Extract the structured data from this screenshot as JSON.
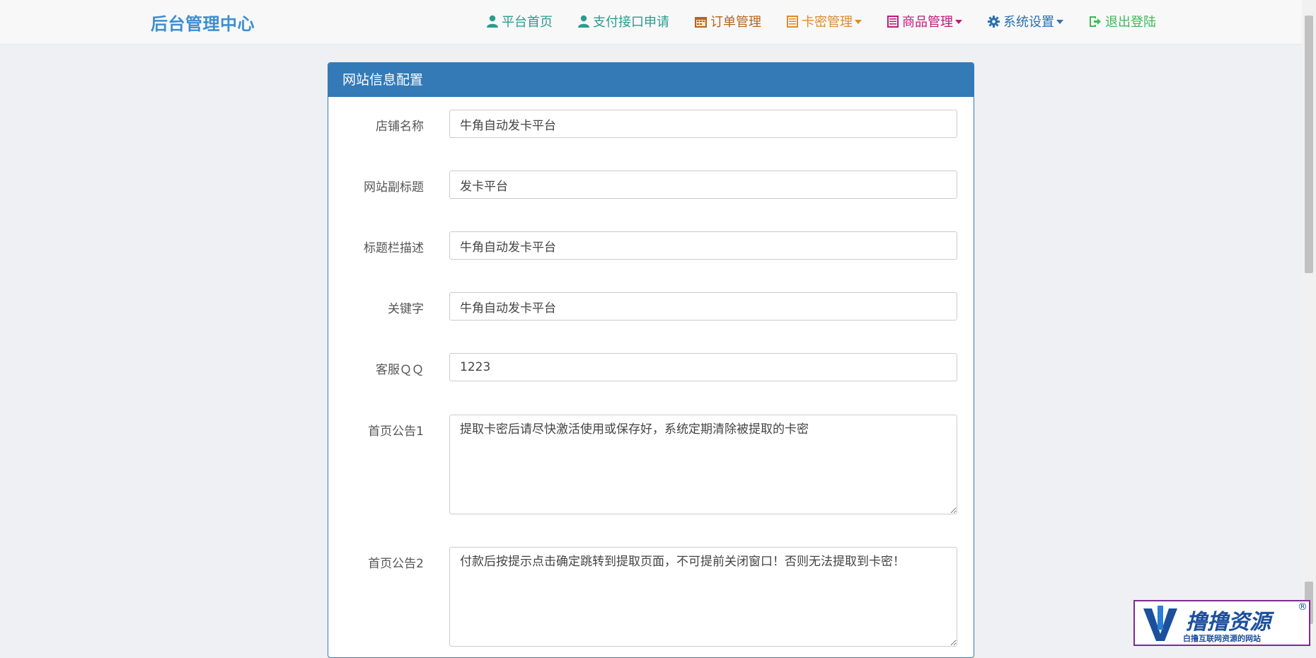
{
  "navbar": {
    "brand": "后台管理中心",
    "items": [
      {
        "label": "平台首页",
        "icon": "user-icon",
        "color": "#2a9d8f"
      },
      {
        "label": "支付接口申请",
        "icon": "user-icon",
        "color": "#2a9d8f"
      },
      {
        "label": "订单管理",
        "icon": "calendar-icon",
        "color": "#b5651d"
      },
      {
        "label": "卡密管理",
        "icon": "list-icon",
        "color": "#e08a2c"
      },
      {
        "label": "商品管理",
        "icon": "list-icon",
        "color": "#c2187a"
      },
      {
        "label": "系统设置",
        "icon": "gear-icon",
        "color": "#2c6fad"
      },
      {
        "label": "退出登陆",
        "icon": "logout-icon",
        "color": "#3cb95a"
      }
    ]
  },
  "panel": {
    "title": "网站信息配置",
    "fields": [
      {
        "label": "店铺名称",
        "value": "牛角自动发卡平台"
      },
      {
        "label": "网站副标题",
        "value": "发卡平台"
      },
      {
        "label": "标题栏描述",
        "value": "牛角自动发卡平台"
      },
      {
        "label": "关键字",
        "value": "牛角自动发卡平台"
      },
      {
        "label": "客服ＱＱ",
        "value": "1223"
      },
      {
        "label": "首页公告1",
        "value": "提取卡密后请尽快激活使用或保存好，系统定期清除被提取的卡密"
      },
      {
        "label": "首页公告2",
        "value": "付款后按提示点击确定跳转到提取页面，不可提前关闭窗口！否则无法提取到卡密！"
      }
    ]
  },
  "watermark": {
    "title": "撸撸资源",
    "subtitle": "白撸互联网资源的网站",
    "reg": "®"
  }
}
